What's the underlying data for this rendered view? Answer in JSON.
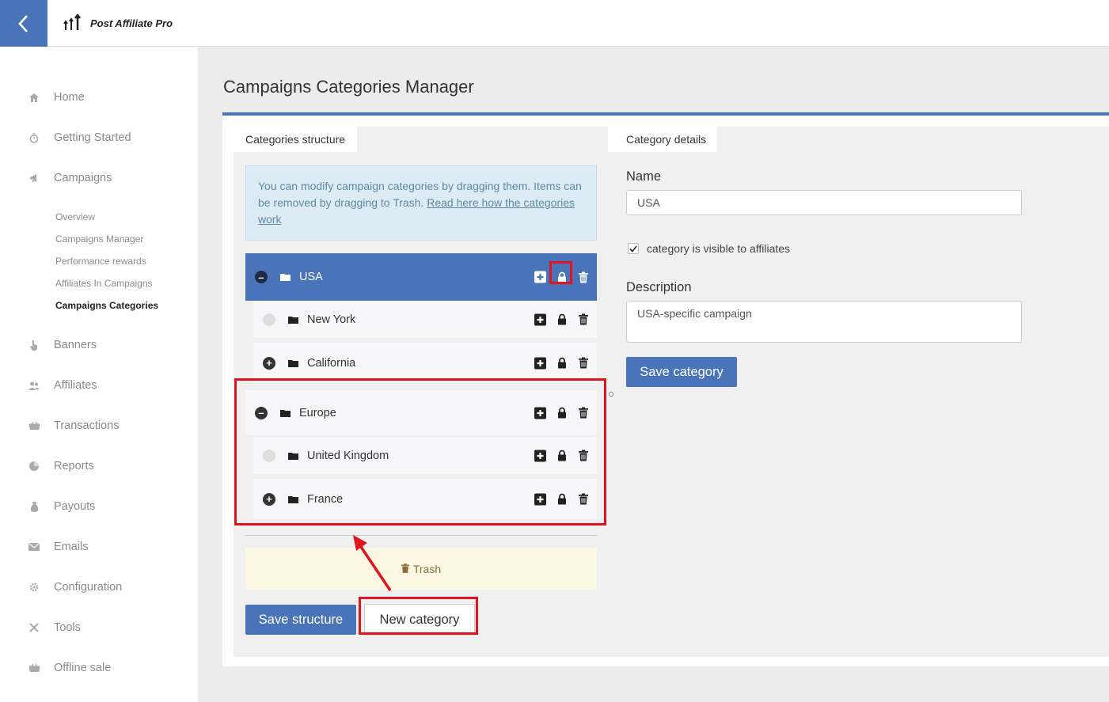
{
  "app": {
    "name": "Post Affiliate Pro"
  },
  "icons": {
    "back": "chevron-left-icon",
    "logo": "arrows-up-icon"
  },
  "sidebar": {
    "items": [
      {
        "label": "Home",
        "icon": "home-icon"
      },
      {
        "label": "Getting Started",
        "icon": "stopwatch-icon"
      },
      {
        "label": "Campaigns",
        "icon": "megaphone-icon"
      },
      {
        "label": "Banners",
        "icon": "pointer-hand-icon"
      },
      {
        "label": "Affiliates",
        "icon": "users-icon"
      },
      {
        "label": "Transactions",
        "icon": "basket-icon"
      },
      {
        "label": "Reports",
        "icon": "pie-chart-icon"
      },
      {
        "label": "Payouts",
        "icon": "money-bag-icon"
      },
      {
        "label": "Emails",
        "icon": "envelope-icon"
      },
      {
        "label": "Configuration",
        "icon": "gear-icon"
      },
      {
        "label": "Tools",
        "icon": "tools-icon"
      },
      {
        "label": "Offline sale",
        "icon": "basket-icon"
      }
    ],
    "campaign_subitems": [
      {
        "label": "Overview"
      },
      {
        "label": "Campaigns Manager"
      },
      {
        "label": "Performance rewards"
      },
      {
        "label": "Affiliates In Campaigns"
      },
      {
        "label": "Campaigns Categories",
        "active": true
      }
    ]
  },
  "page": {
    "title": "Campaigns Categories Manager"
  },
  "structure": {
    "tab_label": "Categories structure",
    "info_text": "You can modify campaign categories by dragging them. Items can be removed by dragging to Trash. ",
    "info_link": "Read here how the categories work",
    "categories": [
      {
        "name": "USA",
        "level": 0,
        "toggle": "collapse",
        "selected": true
      },
      {
        "name": "New York",
        "level": 1,
        "toggle": "none"
      },
      {
        "name": "California",
        "level": 1,
        "toggle": "expand"
      },
      {
        "name": "Europe",
        "level": 0,
        "toggle": "collapse"
      },
      {
        "name": "United Kingdom",
        "level": 1,
        "toggle": "none"
      },
      {
        "name": "France",
        "level": 1,
        "toggle": "expand"
      }
    ],
    "trash_label": "Trash",
    "save_label": "Save structure",
    "new_label": "New category"
  },
  "details": {
    "tab_label": "Category details",
    "name_label": "Name",
    "name_value": "USA",
    "visible_label": "category is visible to affiliates",
    "visible_checked": true,
    "description_label": "Description",
    "description_value": "USA-specific campaign",
    "save_label": "Save category"
  },
  "colors": {
    "accent": "#4a74b9",
    "highlight": "#e0141e",
    "trash_bg": "#fcf8e3",
    "info_bg": "#dcebf4"
  }
}
